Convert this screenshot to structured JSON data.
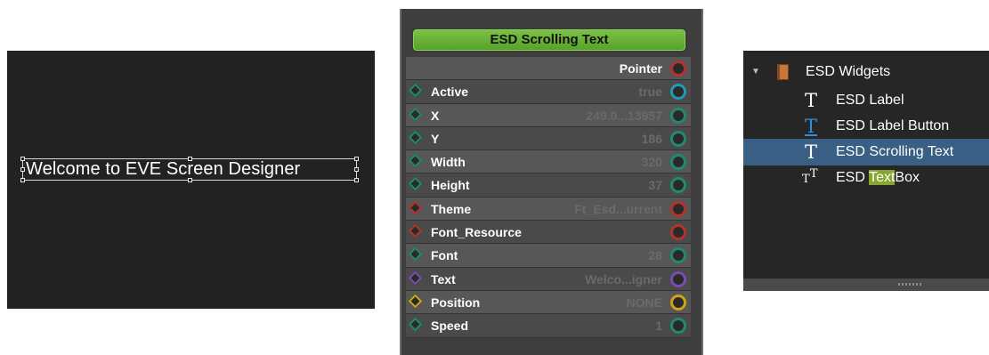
{
  "canvas_preview": {
    "text": "Welcome to EVE Screen Designer"
  },
  "node": {
    "title": "ESD Scrolling Text",
    "pointer_label": "Pointer",
    "properties": [
      {
        "label": "Active",
        "value": "true",
        "active": false,
        "diamond": "#1f8a6e",
        "port": "#1e9ab4"
      },
      {
        "label": "X",
        "value": "249.0...13957",
        "active": false,
        "diamond": "#1f8a6e",
        "port": "#1f8a6e"
      },
      {
        "label": "Y",
        "value": "186",
        "active": false,
        "diamond": "#1f8a6e",
        "port": "#1f8a6e"
      },
      {
        "label": "Width",
        "value": "320",
        "active": false,
        "diamond": "#1f8a6e",
        "port": "#1f8a6e"
      },
      {
        "label": "Height",
        "value": "37",
        "active": false,
        "diamond": "#1f8a6e",
        "port": "#1f8a6e"
      },
      {
        "label": "Theme",
        "value": "Ft_Esd...urrent",
        "active": false,
        "diamond": "#b3332d",
        "port": "#b3332d"
      },
      {
        "label": "Font_Resource",
        "value": "",
        "active": false,
        "diamond": "#b3332d",
        "port": "#b3332d"
      },
      {
        "label": "Font",
        "value": "28",
        "active": false,
        "diamond": "#1f8a6e",
        "port": "#1f8a6e"
      },
      {
        "label": "Text",
        "value": "Welco...igner",
        "active": false,
        "diamond": "#7a4bb0",
        "port": "#7a4bb0"
      },
      {
        "label": "Position",
        "value": "NONE",
        "active": false,
        "diamond": "#d2a21a",
        "port": "#d2a21a"
      },
      {
        "label": "Speed",
        "value": "1",
        "active": false,
        "diamond": "#1f8a6e",
        "port": "#1f8a6e"
      }
    ]
  },
  "tree": {
    "group_label": "ESD Widgets",
    "items": [
      {
        "label": "ESD Label",
        "icon": "T",
        "icon_name": "text-icon"
      },
      {
        "label": "ESD Label Button",
        "icon": "T",
        "icon_name": "label-button-icon"
      },
      {
        "label": "ESD Scrolling Text",
        "icon": "T",
        "icon_name": "text-icon"
      },
      {
        "label_prefix": "ESD ",
        "label_highlight": "Text",
        "label_suffix": "Box",
        "icon": "T",
        "icon_name": "textbox-icon"
      }
    ],
    "selected_index": 2
  },
  "colors": {
    "canvas_bg": "#222222",
    "node_title_green": "#6cb63c",
    "tree_selected": "#3a5f84",
    "search_highlight": "#87a631"
  }
}
